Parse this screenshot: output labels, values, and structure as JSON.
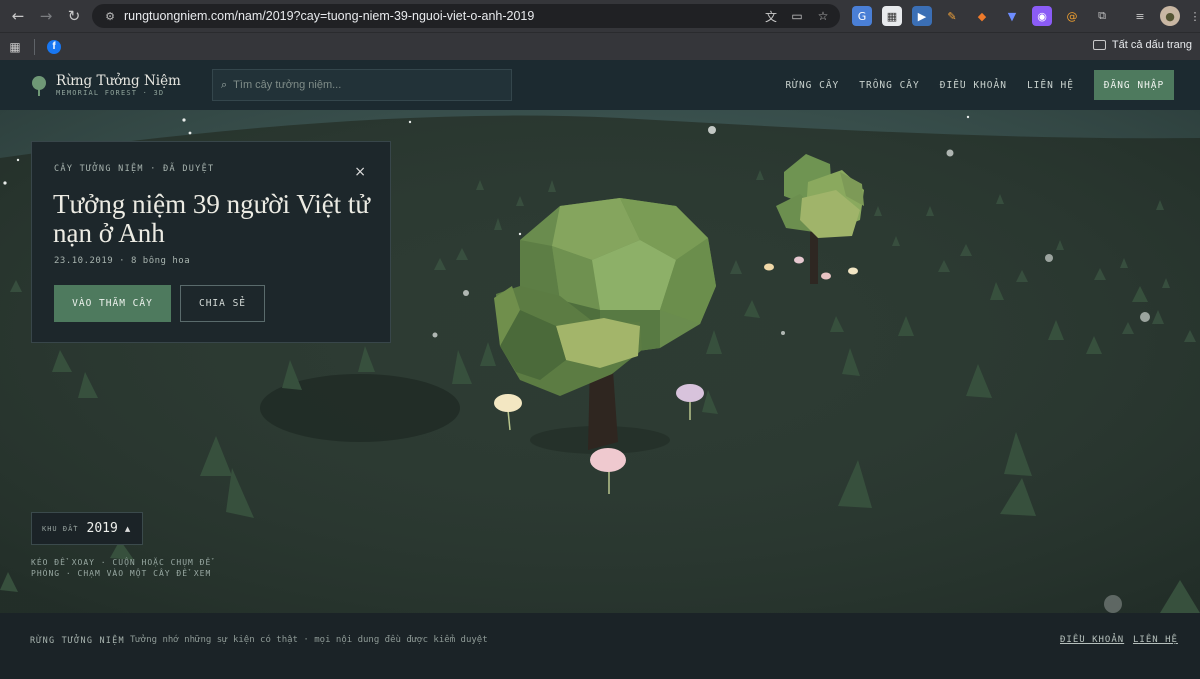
{
  "browser": {
    "url": "rungtuongniem.com/nam/2019?cay=tuong-niem-39-nguoi-viet-o-anh-2019",
    "bookmarks_all_label": "Tất cả dấu trang",
    "bookmark_fb_letter": "f"
  },
  "header": {
    "logo_title": "Rừng Tưởng Niệm",
    "logo_subtitle": "MEMORIAL FOREST · 3D",
    "search_placeholder": "Tìm cây tưởng niệm...",
    "nav": [
      "RỪNG CÂY",
      "TRỒNG CÂY",
      "ĐIỀU KHOẢN",
      "LIÊN HỆ"
    ],
    "login_label": "ĐĂNG NHẬP"
  },
  "card": {
    "kicker": "CÂY TƯỞNG NIỆM · ĐÃ DUYỆT",
    "close": "×",
    "title": "Tưởng niệm 39 người Việt tử nạn ở Anh",
    "meta": "23.10.2019 · 8 bông hoa",
    "primary_label": "VÀO THĂM CÂY",
    "secondary_label": "CHIA SẺ"
  },
  "zone": {
    "label": "KHU ĐẤT",
    "value": "2019",
    "caret": "▲"
  },
  "hint": "KÉO ĐỂ XOAY · CUỘN HOẶC CHỤM ĐỂ PHÓNG · CHẠM VÀO MỘT CÂY ĐỂ XEM",
  "footer": {
    "brand": "RỪNG TƯỞNG NIỆM",
    "note": "Tưởng nhớ những sự kiện có thật · mọi nội dung đều được kiểm duyệt",
    "links": [
      "ĐIỀU KHOẢN",
      "LIÊN HỆ"
    ]
  },
  "colors": {
    "accent": "#4e7a5e",
    "ground": "#2c3a33",
    "sky": "#44605f",
    "flower_cream": "#f3e7c2",
    "flower_pink": "#efc9cf",
    "flower_lilac": "#d8c3dc"
  }
}
